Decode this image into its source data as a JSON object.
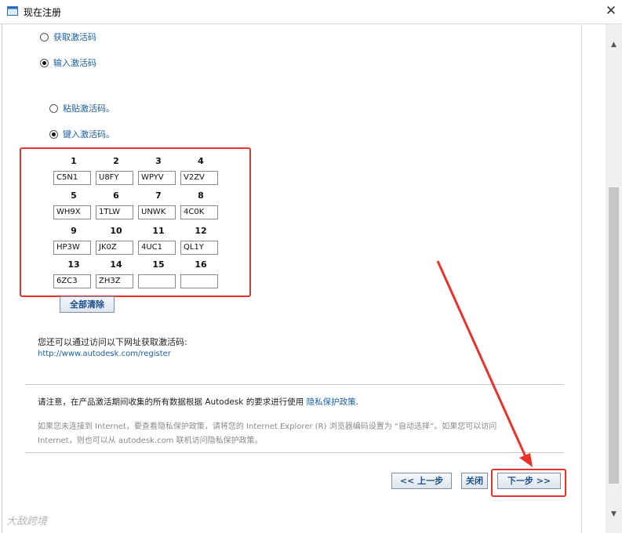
{
  "window": {
    "title": "现在注册",
    "close_glyph": "✕"
  },
  "radios": {
    "get_code": "获取激活码",
    "enter_code": "输入激活码",
    "paste_code": "粘贴激活码。",
    "type_code": "键入激活码。"
  },
  "code_grid": {
    "numbers": [
      "1",
      "2",
      "3",
      "4",
      "5",
      "6",
      "7",
      "8",
      "9",
      "10",
      "11",
      "12",
      "13",
      "14",
      "15",
      "16"
    ],
    "values": [
      "C5N1",
      "U8FY",
      "WPYV",
      "V2ZV",
      "WH9X",
      "1TLW",
      "UNWK",
      "4C0K",
      "HP3W",
      "JK0Z",
      "4UC1",
      "QL1Y",
      "6ZC3",
      "ZH3Z",
      "",
      ""
    ]
  },
  "clear_all_label": "全部清除",
  "info_text": "您还可以通过访问以下网址获取激活码:",
  "register_url": "http://www.autodesk.com/register",
  "notice": {
    "text": "请注意，在产品激活期间收集的所有数据根据 Autodesk 的要求进行使用",
    "link": "隐私保护政策",
    "period": "."
  },
  "gray_note": {
    "line1": "如果您未连接到 Internet，要查看隐私保护政策，请将您的 Internet Explorer (R) 浏览器编码设置为 “自动选择”。如果您可以访问",
    "line2": "Internet，则也可以从 autodesk.com 联机访问隐私保护政策。"
  },
  "buttons": {
    "back": "<< 上一步",
    "close": "关闭",
    "next": "下一步 >>"
  },
  "watermark": "大敌跨境",
  "colors": {
    "highlight_red": "#e8322b",
    "link_blue": "#1a5fa8"
  },
  "icons": {
    "scroll_up": "▲",
    "scroll_down": "▼"
  }
}
